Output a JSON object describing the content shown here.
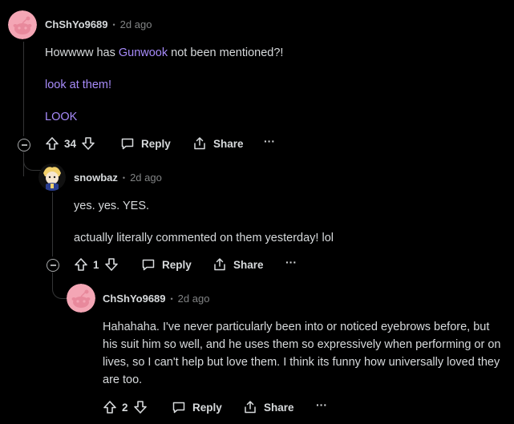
{
  "comments": [
    {
      "username": "ChShYo9689",
      "time": "2d ago",
      "lines": [
        {
          "parts": [
            "Howwww has ",
            "Gunwook",
            " not been mentioned?!"
          ]
        },
        {
          "text": "look at them!"
        },
        {
          "text": "LOOK"
        }
      ],
      "votes": "34",
      "reply_label": "Reply",
      "share_label": "Share",
      "more_label": "···"
    },
    {
      "username": "snowbaz",
      "time": "2d ago",
      "lines": [
        {
          "text": "yes. yes. YES."
        },
        {
          "text": "actually literally commented on them yesterday! lol"
        }
      ],
      "votes": "1",
      "reply_label": "Reply",
      "share_label": "Share",
      "more_label": "···"
    },
    {
      "username": "ChShYo9689",
      "time": "2d ago",
      "lines": [
        {
          "text": "Hahahaha. I've never particularly been into or noticed eyebrows before, but his suit him so well, and he uses them so expressively when performing or on lives, so I can't help but love them. I think its funny how universally loved they are too."
        }
      ],
      "votes": "2",
      "reply_label": "Reply",
      "share_label": "Share",
      "more_label": "···"
    }
  ],
  "separator": "•",
  "colors": {
    "background": "#000000",
    "text": "#d7dadc",
    "muted": "#818384",
    "link": "#a78bfa",
    "avatar_pink": "#f4a6b5"
  }
}
